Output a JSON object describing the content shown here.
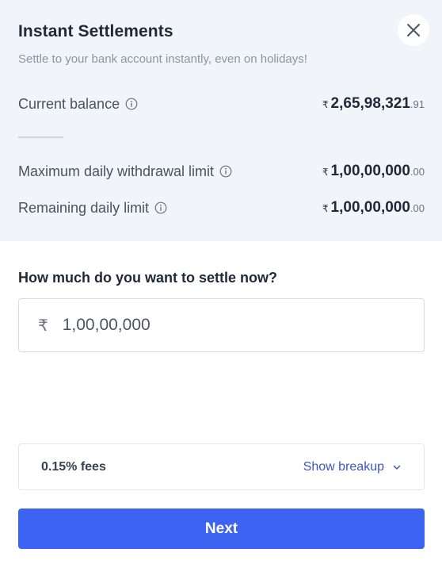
{
  "header": {
    "title": "Instant Settlements",
    "subtitle": "Settle to your bank account instantly, even on holidays!"
  },
  "balances": {
    "current": {
      "label": "Current balance",
      "currency": "₹",
      "main": "2,65,98,321",
      "decimal": ".91"
    },
    "max_daily": {
      "label": "Maximum daily withdrawal limit",
      "currency": "₹",
      "main": "1,00,00,000",
      "decimal": ".00"
    },
    "remaining": {
      "label": "Remaining daily limit",
      "currency": "₹",
      "main": "1,00,00,000",
      "decimal": ".00"
    }
  },
  "settle": {
    "question": "How much do you want to settle now?",
    "currency": "₹",
    "value": "1,00,00,000"
  },
  "fees": {
    "text": "0.15% fees",
    "breakup_label": "Show breakup"
  },
  "actions": {
    "next_label": "Next"
  },
  "icons": {
    "close": "close-icon",
    "info": "info-icon",
    "chevron": "chevron-down-icon"
  },
  "colors": {
    "primary": "#3d63f2",
    "link": "#3a56c5",
    "panel_bg": "#f1f5fa"
  }
}
